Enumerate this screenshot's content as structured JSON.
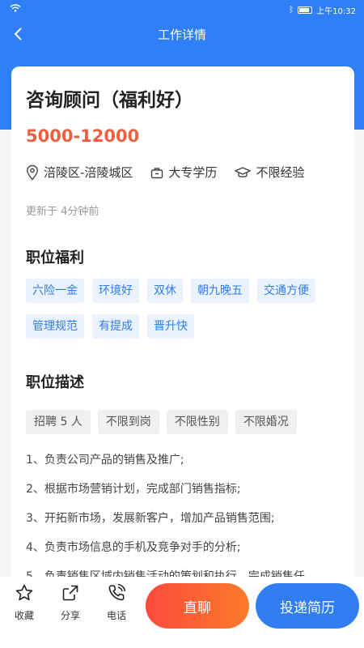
{
  "status_bar": {
    "time": "上午10:32"
  },
  "nav": {
    "title": "工作详情"
  },
  "job": {
    "title": "咨询顾问（福利好）",
    "salary": "5000-12000",
    "location": "涪陵区-涪陵城区",
    "education": "大专学历",
    "experience": "不限经验",
    "updated": "更新于 4分钟前"
  },
  "benefits": {
    "title": "职位福利",
    "tags": [
      "六险一金",
      "环境好",
      "双休",
      "朝九晚五",
      "交通方便",
      "管理规范",
      "有提成",
      "晋升快"
    ]
  },
  "description": {
    "title": "职位描述",
    "tags": [
      "招聘 5 人",
      "不限到岗",
      "不限性别",
      "不限婚况"
    ],
    "duties": [
      "1、负责公司产品的销售及推广;",
      "2、根据市场营销计划，完成部门销售指标;",
      "3、开拓新市场，发展新客户，增加产品销售范围;",
      "4、负责市场信息的手机及竞争对手的分析;",
      "5、负责销售区域内销售活动的策划和执行，完成销售任"
    ]
  },
  "bottom_bar": {
    "favorite": "收藏",
    "share": "分享",
    "phone": "电话",
    "chat": "直聊",
    "apply": "投递简历"
  },
  "colors": {
    "primary": "#2f80f6",
    "salary": "#ef5f3f",
    "chat_start": "#fd4b3c",
    "chat_end": "#fb7a2b"
  }
}
